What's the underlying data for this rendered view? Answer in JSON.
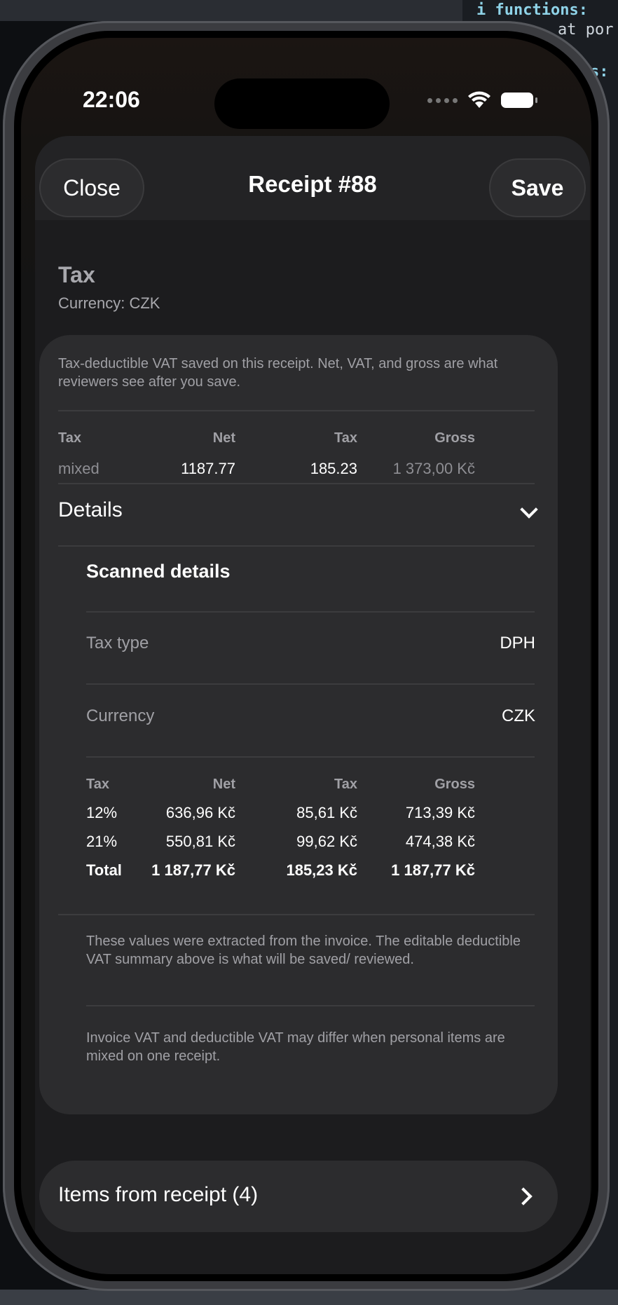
{
  "background_editor": {
    "lines": [
      "i  functions:",
      "at por",
      "s:"
    ]
  },
  "status_bar": {
    "time": "22:06"
  },
  "sheet": {
    "close_label": "Close",
    "title": "Receipt #88",
    "save_label": "Save"
  },
  "tax_section": {
    "title": "Tax",
    "currency_line": "Currency: CZK",
    "note": "Tax-deductible VAT saved on this receipt. Net, VAT, and gross are what reviewers see after you save.",
    "headers": [
      "Tax",
      "Net",
      "Tax",
      "Gross"
    ],
    "row": [
      "mixed",
      "1187.77",
      "185.23",
      "1 373,00 Kč"
    ]
  },
  "details": {
    "label": "Details",
    "scanned_title": "Scanned details",
    "tax_type_label": "Tax type",
    "tax_type_value": "DPH",
    "currency_label": "Currency",
    "currency_value": "CZK",
    "headers": [
      "Tax",
      "Net",
      "Tax",
      "Gross"
    ],
    "rows": [
      [
        "12%",
        "636,96 Kč",
        "85,61 Kč",
        "713,39 Kč"
      ],
      [
        "21%",
        "550,81 Kč",
        "99,62 Kč",
        "474,38 Kč"
      ],
      [
        "Total",
        "1 187,77 Kč",
        "185,23 Kč",
        "1 187,77 Kč"
      ]
    ],
    "note_extracted": "These values were extracted from the invoice. The editable deductible VAT summary above is what will be saved/ reviewed.",
    "note_differ": "Invoice VAT and deductible VAT may differ when personal items are mixed on one receipt."
  },
  "items": {
    "label": "Items from receipt (4)"
  }
}
